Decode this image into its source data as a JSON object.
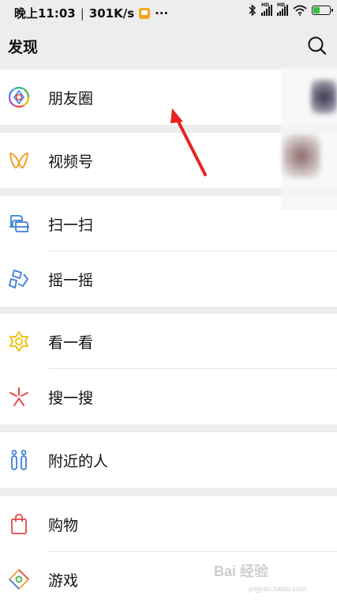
{
  "status_bar": {
    "time": "晚上11:03",
    "separator": "|",
    "network_speed": "301K/s",
    "more": "···",
    "app_badge_icon": "orange-app-badge-icon",
    "right_icons": [
      "bluetooth-icon",
      "hd-signal-icon",
      "hd-signal-icon",
      "wifi-icon",
      "battery-icon"
    ],
    "hd_label": "HD",
    "battery_level": 0.4,
    "battery_color": "#2fbf3f"
  },
  "header": {
    "title": "发现",
    "search_icon": "search-icon"
  },
  "menu": {
    "items": [
      {
        "label": "朋友圈",
        "icon": "moments-aperture-icon"
      },
      {
        "label": "视频号",
        "icon": "channels-butterfly-icon"
      },
      {
        "label": "扫一扫",
        "icon": "scan-icon"
      },
      {
        "label": "摇一摇",
        "icon": "shake-icon"
      },
      {
        "label": "看一看",
        "icon": "top-stories-icon"
      },
      {
        "label": "搜一搜",
        "icon": "search-sparkle-icon"
      },
      {
        "label": "附近的人",
        "icon": "people-nearby-icon"
      },
      {
        "label": "购物",
        "icon": "shopping-bag-icon"
      },
      {
        "label": "游戏",
        "icon": "game-diamond-icon"
      }
    ]
  },
  "annotation": {
    "arrow_color": "#e8231f"
  },
  "watermark": {
    "text": "Bai 经验",
    "sub": "jingyan.baidu.com"
  },
  "colors": {
    "page_bg": "#ededed",
    "row_bg": "#ffffff",
    "divider": "#e5e5e5"
  }
}
